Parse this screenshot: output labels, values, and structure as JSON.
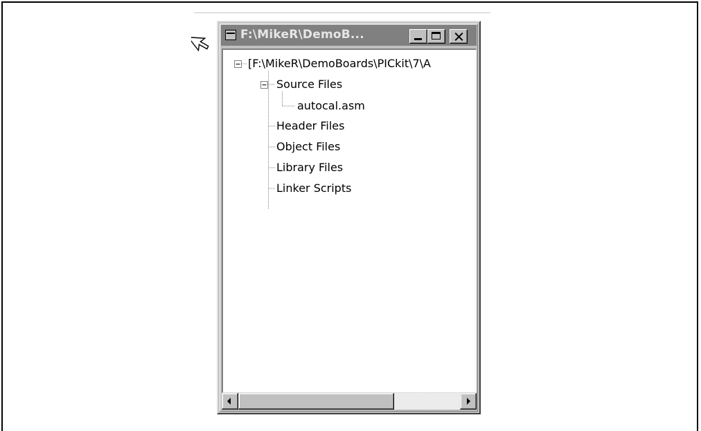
{
  "window": {
    "title": "F:\\MikeR\\DemoB...",
    "title_full_hint": "",
    "buttons": {
      "minimize": "minimize",
      "maximize": "maximize",
      "close": "close"
    }
  },
  "tree": {
    "root": "[F:\\MikeR\\DemoBoards\\PICkit\\7\\A",
    "source_files": "Source Files",
    "source_child": "autocal.asm",
    "header_files": "Header Files",
    "object_files": "Object Files",
    "library_files": "Library Files",
    "linker_scripts": "Linker Scripts"
  },
  "icons": {
    "cursor": "mouse-pointer-icon",
    "system_menu": "window-menu-icon",
    "expand_toggle": "minus-box-icon",
    "scroll_left": "arrow-left-icon",
    "scroll_right": "arrow-right-icon"
  },
  "colors": {
    "titlebar_inactive": "#808080",
    "window_face": "#c0c0c0",
    "client_bg": "#ffffff"
  }
}
